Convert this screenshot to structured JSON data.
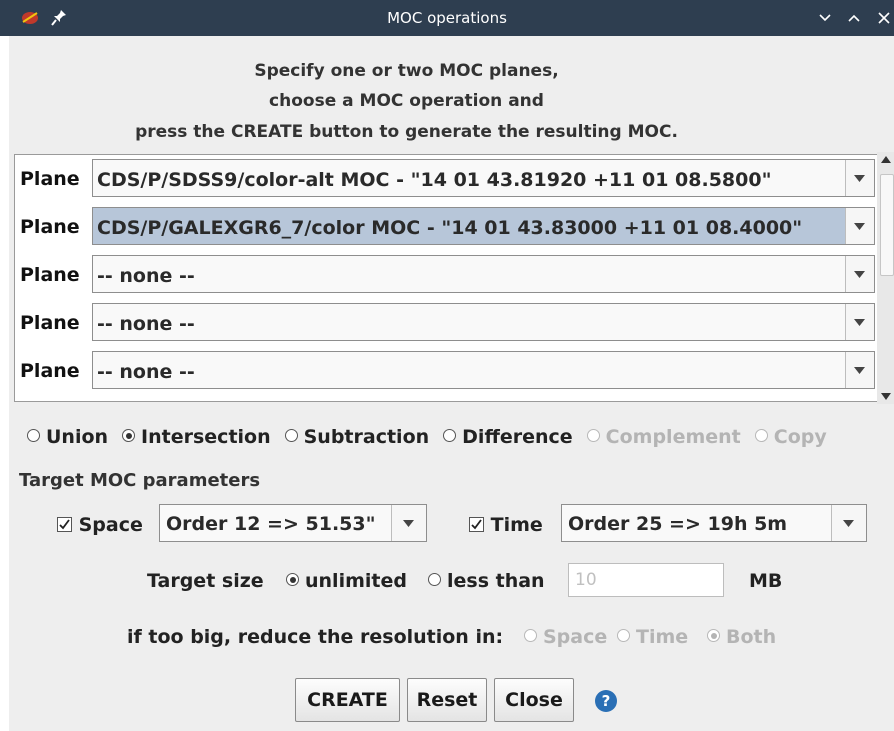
{
  "window": {
    "title": "MOC operations"
  },
  "instructions": [
    "Specify one or two MOC planes,",
    "choose a MOC operation and",
    "press the CREATE button to generate the resulting MOC."
  ],
  "planes": [
    {
      "label": "Plane",
      "value": "CDS/P/SDSS9/color-alt MOC - \"14 01 43.81920 +11 01 08.5800\"",
      "selected": false
    },
    {
      "label": "Plane",
      "value": "CDS/P/GALEXGR6_7/color MOC - \"14 01 43.83000 +11 01 08.4000\"",
      "selected": true
    },
    {
      "label": "Plane",
      "value": "-- none --",
      "selected": false
    },
    {
      "label": "Plane",
      "value": "-- none --",
      "selected": false
    },
    {
      "label": "Plane",
      "value": "-- none --",
      "selected": false
    }
  ],
  "operations": [
    {
      "label": "Union",
      "checked": false,
      "enabled": true
    },
    {
      "label": "Intersection",
      "checked": true,
      "enabled": true
    },
    {
      "label": "Subtraction",
      "checked": false,
      "enabled": true
    },
    {
      "label": "Difference",
      "checked": false,
      "enabled": true
    },
    {
      "label": "Complement",
      "checked": false,
      "enabled": false
    },
    {
      "label": "Copy",
      "checked": false,
      "enabled": false
    }
  ],
  "target": {
    "section_title": "Target MOC parameters",
    "space": {
      "label": "Space",
      "checked": true,
      "order": "Order 12 => 51.53\""
    },
    "time": {
      "label": "Time",
      "checked": true,
      "order": "Order 25 => 19h 5m"
    },
    "size_label": "Target size",
    "size_options": [
      {
        "label": "unlimited",
        "checked": true
      },
      {
        "label": "less than",
        "checked": false
      }
    ],
    "size_value": "10",
    "size_unit": "MB",
    "reduce_label": "if too big, reduce the resolution in:",
    "reduce_options": [
      {
        "label": "Space",
        "checked": false
      },
      {
        "label": "Time",
        "checked": false
      },
      {
        "label": "Both",
        "checked": true
      }
    ]
  },
  "buttons": {
    "create": "CREATE",
    "reset": "Reset",
    "close": "Close"
  },
  "icons": {
    "app": "aladin-app-icon",
    "pin": "pin-icon",
    "help": "help-icon",
    "window_controls": [
      "chevron-down-icon",
      "chevron-up-icon",
      "close-icon"
    ]
  },
  "colors": {
    "titlebar": "#2e3e50",
    "dialog_bg": "#eeeeee",
    "selected_row": "#b7c6d9",
    "help": "#2a6fb5"
  }
}
